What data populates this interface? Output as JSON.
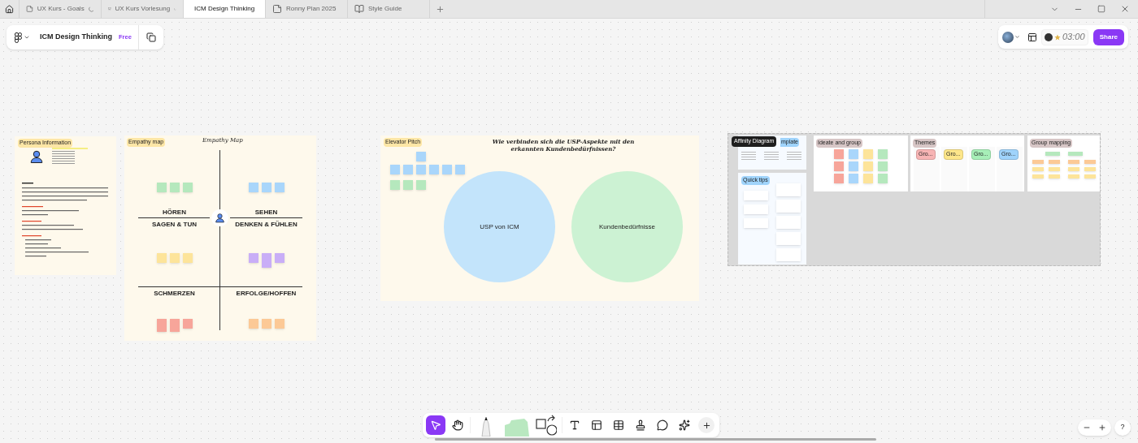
{
  "tabs": [
    {
      "label": "UX Kurs - Goals",
      "kind": "board",
      "loading": true,
      "selected": false
    },
    {
      "label": "UX Kurs Vorlesung",
      "kind": "slides",
      "loading": true,
      "selected": false
    },
    {
      "label": "ICM Design Thinking",
      "kind": "board",
      "loading": false,
      "selected": true
    },
    {
      "label": "Ronny Plan 2025",
      "kind": "board",
      "loading": false,
      "selected": false
    },
    {
      "label": "Style Guide",
      "kind": "book",
      "loading": false,
      "selected": false
    }
  ],
  "file": {
    "title": "ICM Design Thinking",
    "plan": "Free"
  },
  "timer": "03:00",
  "share": "Share",
  "persona": {
    "label": "Persona Information"
  },
  "empathy": {
    "label": "Empathy map",
    "title": "Empathy Map",
    "quadrant_labels": [
      "HÖREN",
      "SEHEN",
      "SAGEN & TUN",
      "DENKEN & FÜHLEN",
      "SCHMERZEN",
      "ERFOLGE/HOFFEN"
    ]
  },
  "elevator": {
    "label": "Elevator Pitch",
    "question": "Wie verbinden sich die USP-Aspekte mit den erkannten Kundenbedürfnissen?",
    "circles": [
      {
        "label": "USP von ICM",
        "color": "#c3e4fb"
      },
      {
        "label": "Kundenbedürfnisse",
        "color": "#ccf2d3"
      }
    ]
  },
  "affinity": {
    "tooltip": "Affinity Diagram",
    "template_label": "mplate",
    "quick_tips": "Quick tips",
    "ideate": "Ideate and group",
    "themes": "Themes",
    "groups": [
      {
        "label": "Gro...",
        "color": "#f7b4b4"
      },
      {
        "label": "Gro...",
        "color": "#fde68a"
      },
      {
        "label": "Gro...",
        "color": "#a7efb8"
      },
      {
        "label": "Gro...",
        "color": "#9fd3fb"
      }
    ],
    "group_mapping": "Group mapping"
  },
  "tools": [
    {
      "kind": "pointer",
      "selected": true
    },
    {
      "kind": "hand",
      "selected": false
    },
    {
      "kind": "marker",
      "selected": false
    },
    {
      "kind": "sticky",
      "selected": false
    },
    {
      "kind": "shape",
      "selected": false
    },
    {
      "kind": "text",
      "selected": false
    },
    {
      "kind": "section",
      "selected": false
    },
    {
      "kind": "table",
      "selected": false
    },
    {
      "kind": "stamp",
      "selected": false
    },
    {
      "kind": "comment",
      "selected": false
    },
    {
      "kind": "ai",
      "selected": false
    },
    {
      "kind": "more",
      "selected": false
    }
  ],
  "help": "?"
}
